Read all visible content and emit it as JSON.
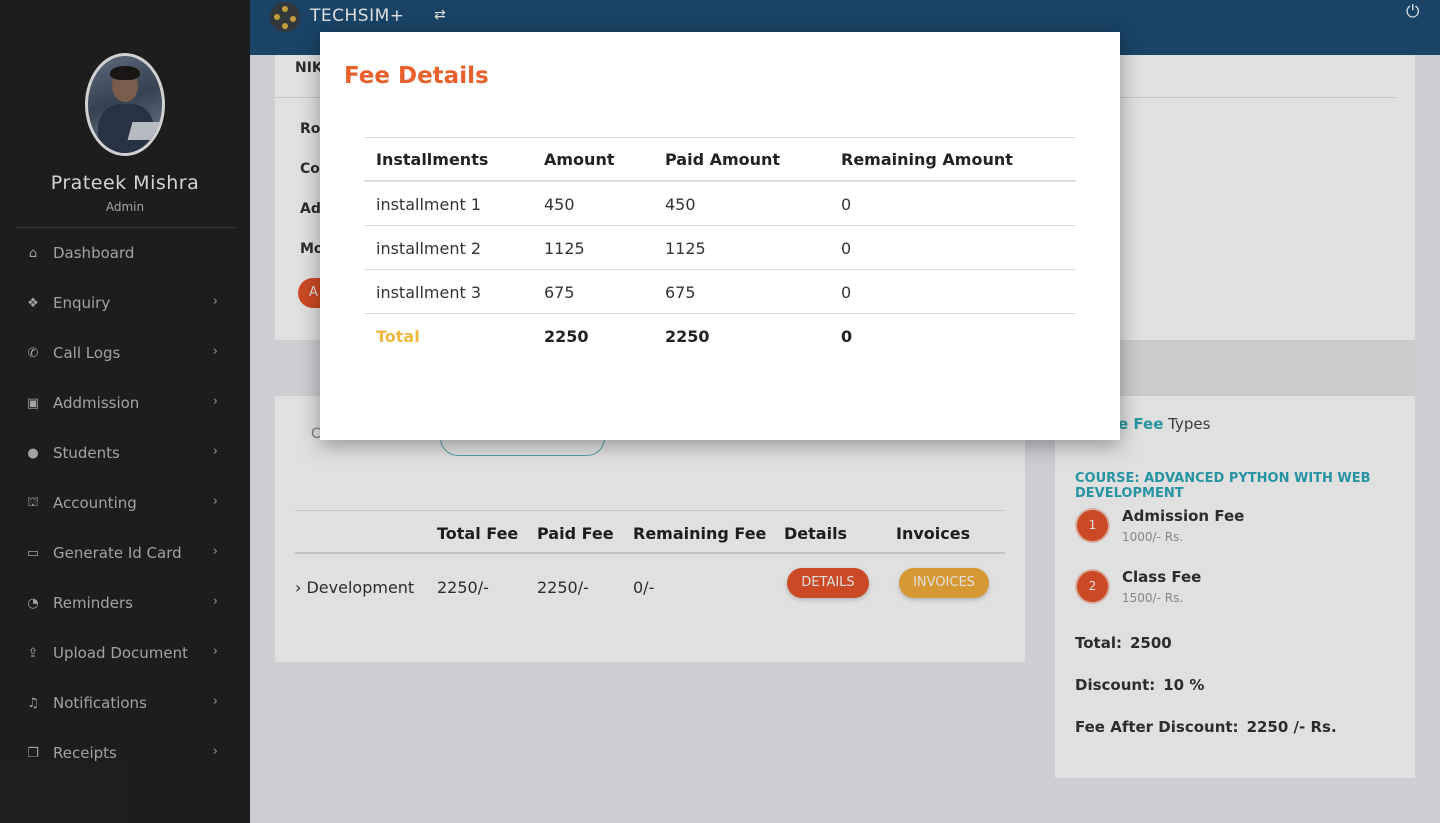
{
  "sidebar": {
    "user_name": "Prateek Mishra",
    "user_role": "Admin",
    "items": [
      {
        "label": "Dashboard",
        "icon": "home-icon",
        "glyph": "⌂"
      },
      {
        "label": "Enquiry",
        "icon": "book-icon",
        "glyph": "❖"
      },
      {
        "label": "Call Logs",
        "icon": "phone-icon",
        "glyph": "✆"
      },
      {
        "label": "Addmission",
        "icon": "contact-card-icon",
        "glyph": "▣"
      },
      {
        "label": "Students",
        "icon": "account-circle-icon",
        "glyph": "●"
      },
      {
        "label": "Accounting",
        "icon": "bank-icon",
        "glyph": "⛫"
      },
      {
        "label": "Generate Id Card",
        "icon": "card-icon",
        "glyph": "▭"
      },
      {
        "label": "Reminders",
        "icon": "alarm-icon",
        "glyph": "◔"
      },
      {
        "label": "Upload Document",
        "icon": "upload-icon",
        "glyph": "⇪"
      },
      {
        "label": "Notifications",
        "icon": "bell-icon",
        "glyph": "♫"
      },
      {
        "label": "Receipts",
        "icon": "copy-icon",
        "glyph": "❐"
      }
    ]
  },
  "topbar": {
    "brand": "TECHSIM+",
    "swap_glyph": "⇄",
    "power_glyph": "⏻"
  },
  "background": {
    "student_name_partial": "NIK",
    "labels_partial": [
      "Ro",
      "Co",
      "Ad",
      "Mo"
    ],
    "button_partial": "A",
    "search_label_partial": "C",
    "fee_table": {
      "headers": [
        "Total Fee",
        "Paid Fee",
        "Remaining Fee",
        "Details",
        "Invoices"
      ],
      "row": {
        "course": "› Development",
        "total_fee": "2250/-",
        "paid_fee": "2250/-",
        "remaining_fee": "0/-"
      },
      "details_button": "DETAILS",
      "invoices_button": "INVOICES"
    },
    "fee_types": {
      "title_accent": "e Fee",
      "title_rest": " Types",
      "course_title": "COURSE: ADVANCED PYTHON WITH WEB DEVELOPMENT",
      "items": [
        {
          "num": "1",
          "name": "Admission Fee",
          "amount": "1000/- Rs."
        },
        {
          "num": "2",
          "name": "Class Fee",
          "amount": "1500/- Rs."
        }
      ],
      "total_label": "Total:",
      "total_value": "2500",
      "discount_label": "Discount:",
      "discount_value": "10 %",
      "after_label": "Fee After Discount:",
      "after_value": "2250 /- Rs."
    }
  },
  "modal": {
    "title": "Fee Details",
    "headers": [
      "Installments",
      "Amount",
      "Paid Amount",
      "Remaining Amount"
    ],
    "rows": [
      [
        "installment 1",
        "450",
        "450",
        "0"
      ],
      [
        "installment 2",
        "1125",
        "1125",
        "0"
      ],
      [
        "installment 3",
        "675",
        "675",
        "0"
      ]
    ],
    "total": [
      "Total",
      "2250",
      "2250",
      "0"
    ]
  },
  "colors": {
    "accent_orange": "#e8612c",
    "accent_yellow": "#f0b840",
    "accent_teal": "#2ca9b9",
    "topbar": "#1e4d73",
    "sidebar": "#222222"
  }
}
